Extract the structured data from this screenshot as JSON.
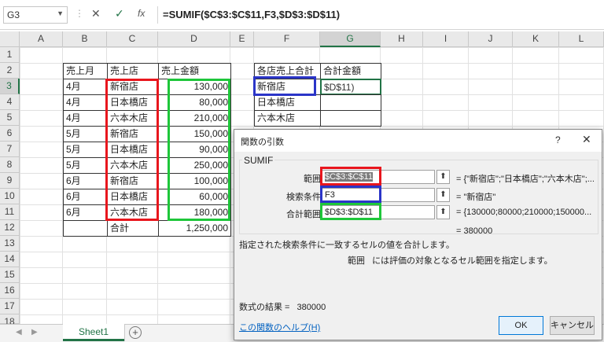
{
  "formula_bar": {
    "name_box": "G3",
    "cancel_glyph": "✕",
    "enter_glyph": "✓",
    "fx_label": "fx",
    "formula": "=SUMIF($C$3:$C$11,F3,$D$3:$D$11)"
  },
  "columns": [
    "A",
    "B",
    "C",
    "D",
    "E",
    "F",
    "G",
    "H",
    "I",
    "J",
    "K",
    "L"
  ],
  "rows": [
    "1",
    "2",
    "3",
    "4",
    "5",
    "6",
    "7",
    "8",
    "9",
    "10",
    "11",
    "12",
    "13",
    "14",
    "15",
    "16",
    "17",
    "18"
  ],
  "table1": {
    "headers": [
      "売上月",
      "売上店",
      "売上金額"
    ],
    "rows": [
      [
        "4月",
        "新宿店",
        "130,000"
      ],
      [
        "4月",
        "日本橋店",
        "80,000"
      ],
      [
        "4月",
        "六本木店",
        "210,000"
      ],
      [
        "5月",
        "新宿店",
        "150,000"
      ],
      [
        "5月",
        "日本橋店",
        "90,000"
      ],
      [
        "5月",
        "六本木店",
        "250,000"
      ],
      [
        "6月",
        "新宿店",
        "100,000"
      ],
      [
        "6月",
        "日本橋店",
        "60,000"
      ],
      [
        "6月",
        "六本木店",
        "180,000"
      ]
    ],
    "total_label": "合計",
    "total_value": "1,250,000"
  },
  "table2": {
    "headers": [
      "各店売上合計",
      "合計金額"
    ],
    "stores": [
      "新宿店",
      "日本橋店",
      "六本木店"
    ],
    "g3_value": "$D$11)"
  },
  "highlight_colors": {
    "red": "#e8161d",
    "green": "#1ec63a",
    "blue": "#2b35c8",
    "excel_green": "#217346"
  },
  "sheet_tabs": {
    "active": "Sheet1",
    "add_glyph": "+"
  },
  "dialog": {
    "title": "関数の引数",
    "help_glyph": "?",
    "close_glyph": "✕",
    "function_name": "SUMIF",
    "args": [
      {
        "label": "範囲",
        "value": "$C$3:$C$11",
        "result": "=  {\"新宿店\";\"日本橋店\";\"六本木店\";..."
      },
      {
        "label": "検索条件",
        "value": "F3",
        "result": "=  \"新宿店\""
      },
      {
        "label": "合計範囲",
        "value": "$D$3:$D$11",
        "result": "=  {130000;80000;210000;150000..."
      }
    ],
    "ref_glyph": "⬆",
    "total": "=  380000",
    "description": "指定された検索条件に一致するセルの値を合計します。",
    "arg_help_name": "範囲",
    "arg_help_text": "には評価の対象となるセル範囲を指定します。",
    "formula_result_label": "数式の結果 =",
    "formula_result_value": "380000",
    "help_link": "この関数のヘルプ(H)",
    "ok_label": "OK",
    "cancel_label": "キャンセル"
  }
}
